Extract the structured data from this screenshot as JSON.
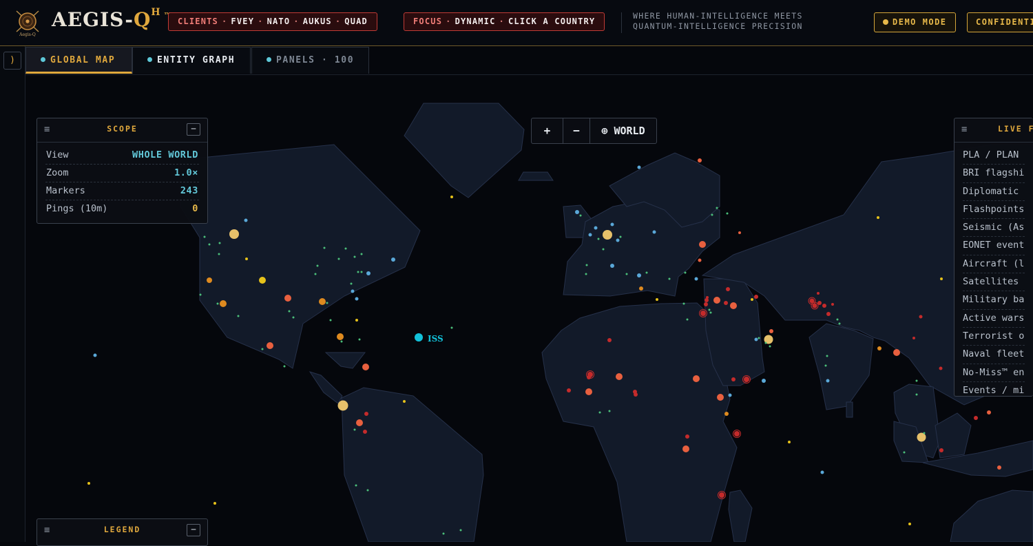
{
  "header": {
    "brand_main": "AEGIS-",
    "brand_accent": "Q",
    "brand_sup": "H",
    "brand_tm": "™",
    "emblem_caption": "Aegis-Q",
    "clients_label": "CLIENTS",
    "clients": [
      "FVEY",
      "NATO",
      "AUKUS",
      "QUAD"
    ],
    "focus_label": "FOCUS",
    "focus_items": [
      "DYNAMIC",
      "CLICK A COUNTRY"
    ],
    "tagline_line1": "WHERE HUMAN-INTELLIGENCE MEETS",
    "tagline_line2": "QUANTUM-INTELLIGENCE PRECISION",
    "demo_label": "DEMO MODE",
    "confidential_label": "CONFIDENTIAL"
  },
  "sidebar": {
    "toggle_icon": ")"
  },
  "tabs": [
    {
      "label": "GLOBAL MAP"
    },
    {
      "label": "ENTITY GRAPH"
    },
    {
      "label": "PANELS · 100"
    }
  ],
  "zoom_controls": {
    "zoom_in": "+",
    "zoom_out": "−",
    "world_label": "⊕ WORLD"
  },
  "scope_panel": {
    "title": "SCOPE",
    "rows": [
      {
        "key": "View",
        "value": "WHOLE WORLD"
      },
      {
        "key": "Zoom",
        "value": "1.0×"
      },
      {
        "key": "Markers",
        "value": "243"
      },
      {
        "key": "Pings (10m)",
        "value": "0"
      }
    ]
  },
  "live_feed_panel": {
    "title": "LIVE F",
    "rows": [
      "PLA / PLAN /",
      "BRI flagship",
      "Diplomatic po",
      "Flashpoints",
      "Seismic (Asia",
      "EONET events",
      "Aircraft (liv",
      "Satellites",
      "Military base",
      "Active wars",
      "Terrorist org",
      "Naval fleets",
      "No-Miss™ enve",
      "Events / min"
    ]
  },
  "legend_panel": {
    "title": "LEGEND"
  },
  "map": {
    "iss_label": "ISS",
    "colors": {
      "land": "#121a29",
      "land_stroke": "#26314a",
      "ocean": "#05070c",
      "hotspot": "#e8603f",
      "conflict": "#c42b2b",
      "base": "#de8a1f",
      "gold": "#e6c06a",
      "allied": "#5aa8d8",
      "event": "#e6c21a",
      "node": "#4bbf7a",
      "iss": "#12c1da"
    }
  }
}
